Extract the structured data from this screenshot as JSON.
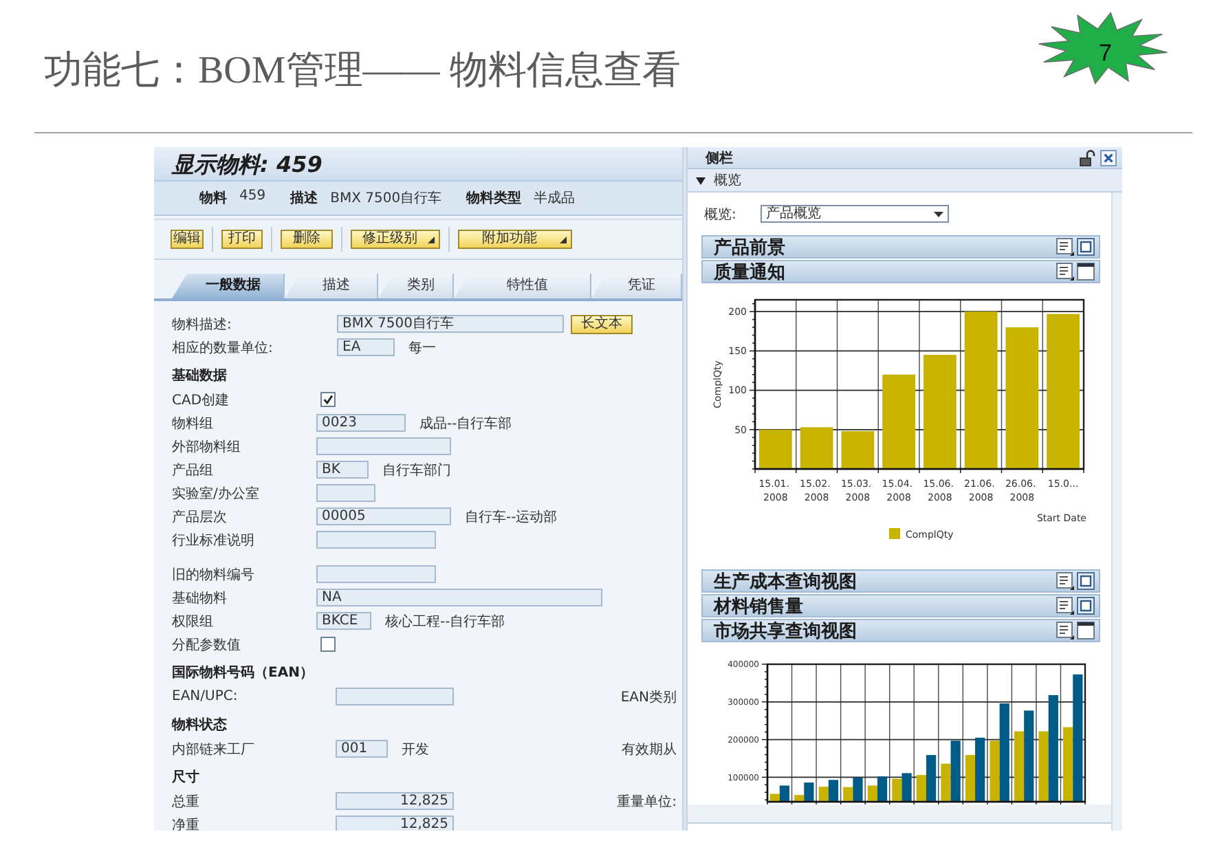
{
  "slide": {
    "title": "功能七：BOM管理—— 物料信息查看",
    "page_number": "7"
  },
  "material_screen": {
    "title": "显示物料: 459",
    "header_fields": [
      {
        "label": "物料",
        "value": "459"
      },
      {
        "label": "描述",
        "value": "BMX 7500自行车"
      },
      {
        "label": "物料类型",
        "value": "半成品"
      }
    ],
    "toolbar": [
      {
        "label": "编辑",
        "kind": "plain"
      },
      {
        "label": "打印",
        "kind": "plain"
      },
      {
        "label": "删除",
        "kind": "plain"
      },
      {
        "label": "修正级别",
        "kind": "menu"
      },
      {
        "label": "附加功能",
        "kind": "menu"
      }
    ],
    "tabs": [
      {
        "label": "一般数据",
        "selected": true
      },
      {
        "label": "描述",
        "selected": false
      },
      {
        "label": "类别",
        "selected": false
      },
      {
        "label": "特性值",
        "selected": false
      },
      {
        "label": "凭证",
        "selected": false
      }
    ],
    "sections": [
      {
        "rows": [
          {
            "kind": "field",
            "label": "物料描述:",
            "value": "BMX 7500自行车",
            "button": "长文本"
          },
          {
            "kind": "field",
            "label": "相应的数量单位:",
            "value": "EA",
            "note": "每一"
          }
        ]
      },
      {
        "title": "基础数据",
        "rows": [
          {
            "kind": "checkbox",
            "label": "CAD创建",
            "checked": true
          },
          {
            "kind": "field",
            "label": "物料组",
            "value": "0023",
            "note": "成品--自行车部"
          },
          {
            "kind": "field",
            "label": "外部物料组"
          },
          {
            "kind": "field",
            "label": "产品组",
            "value": "BK",
            "note": "自行车部门"
          },
          {
            "kind": "field",
            "label": "实验室/办公室"
          },
          {
            "kind": "field",
            "label": "产品层次",
            "value": "00005",
            "note": "自行车--运动部"
          },
          {
            "kind": "field",
            "label": "行业标准说明"
          },
          {
            "kind": "field",
            "label": "旧的物料编号"
          },
          {
            "kind": "field",
            "label": "基础物料",
            "value": "NA"
          },
          {
            "kind": "field",
            "label": "权限组",
            "value": "BKCE",
            "note": "核心工程--自行车部"
          },
          {
            "kind": "checkbox",
            "label": "分配参数值",
            "checked": false
          }
        ]
      },
      {
        "title": "国际物料号码（EAN）",
        "rows": [
          {
            "kind": "field",
            "label": "EAN/UPC:",
            "side_label": "EAN类别"
          }
        ]
      },
      {
        "title": "物料状态",
        "rows": [
          {
            "kind": "field",
            "label": "内部链来工厂",
            "value": "001",
            "note": "开发",
            "side_label": "有效期从"
          }
        ]
      },
      {
        "title": "尺寸",
        "rows": [
          {
            "kind": "number",
            "label": "总重",
            "value": "12,825",
            "side_label": "重量单位:"
          },
          {
            "kind": "number",
            "label": "净重",
            "value": "12,825"
          }
        ]
      }
    ]
  },
  "side_panel": {
    "title": "侧栏",
    "overview": {
      "title": "概览",
      "expanded": true,
      "view_label": "概览:",
      "view_value": "产品概览"
    },
    "sections": [
      {
        "title": "产品前景",
        "expanded": false
      },
      {
        "title": "质量通知",
        "expanded": true,
        "chart_data": {
          "type": "bar",
          "grid": true,
          "xlabel": "Start Date",
          "ylabel": "ComplQty",
          "categories": [
            "15.01. 2008",
            "15.02. 2008",
            "15.03. 2008",
            "15.04. 2008",
            "15.06. 2008",
            "21.06. 2008",
            "26.06. 2008",
            "15.0..."
          ],
          "series": [
            {
              "name": "ComplQty",
              "color": "#c8b400",
              "values": [
                50,
                53,
                48,
                120,
                145,
                200,
                180,
                197
              ]
            }
          ],
          "ylim": [
            0,
            215
          ],
          "yticks": [
            50,
            100,
            150,
            200
          ]
        }
      },
      {
        "title": "生产成本查询视图",
        "expanded": false
      },
      {
        "title": "材料销售量",
        "expanded": false
      },
      {
        "title": "市场共享查询视图",
        "expanded": true,
        "chart_data": {
          "type": "bar",
          "grid": true,
          "series": [
            {
              "color": "#c8b400",
              "values": [
                56000,
                53000,
                75000,
                74000,
                78000,
                96000,
                106000,
                136000,
                159000,
                197000,
                222000,
                222000,
                233000
              ]
            },
            {
              "color": "#005b86",
              "values": [
                78000,
                86000,
                93000,
                99000,
                102000,
                111000,
                159000,
                197000,
                205000,
                296000,
                277000,
                318000,
                373000
              ]
            }
          ],
          "ylim": [
            35000,
            400000
          ],
          "yticks": [
            100000,
            200000,
            300000,
            400000
          ]
        }
      }
    ]
  }
}
